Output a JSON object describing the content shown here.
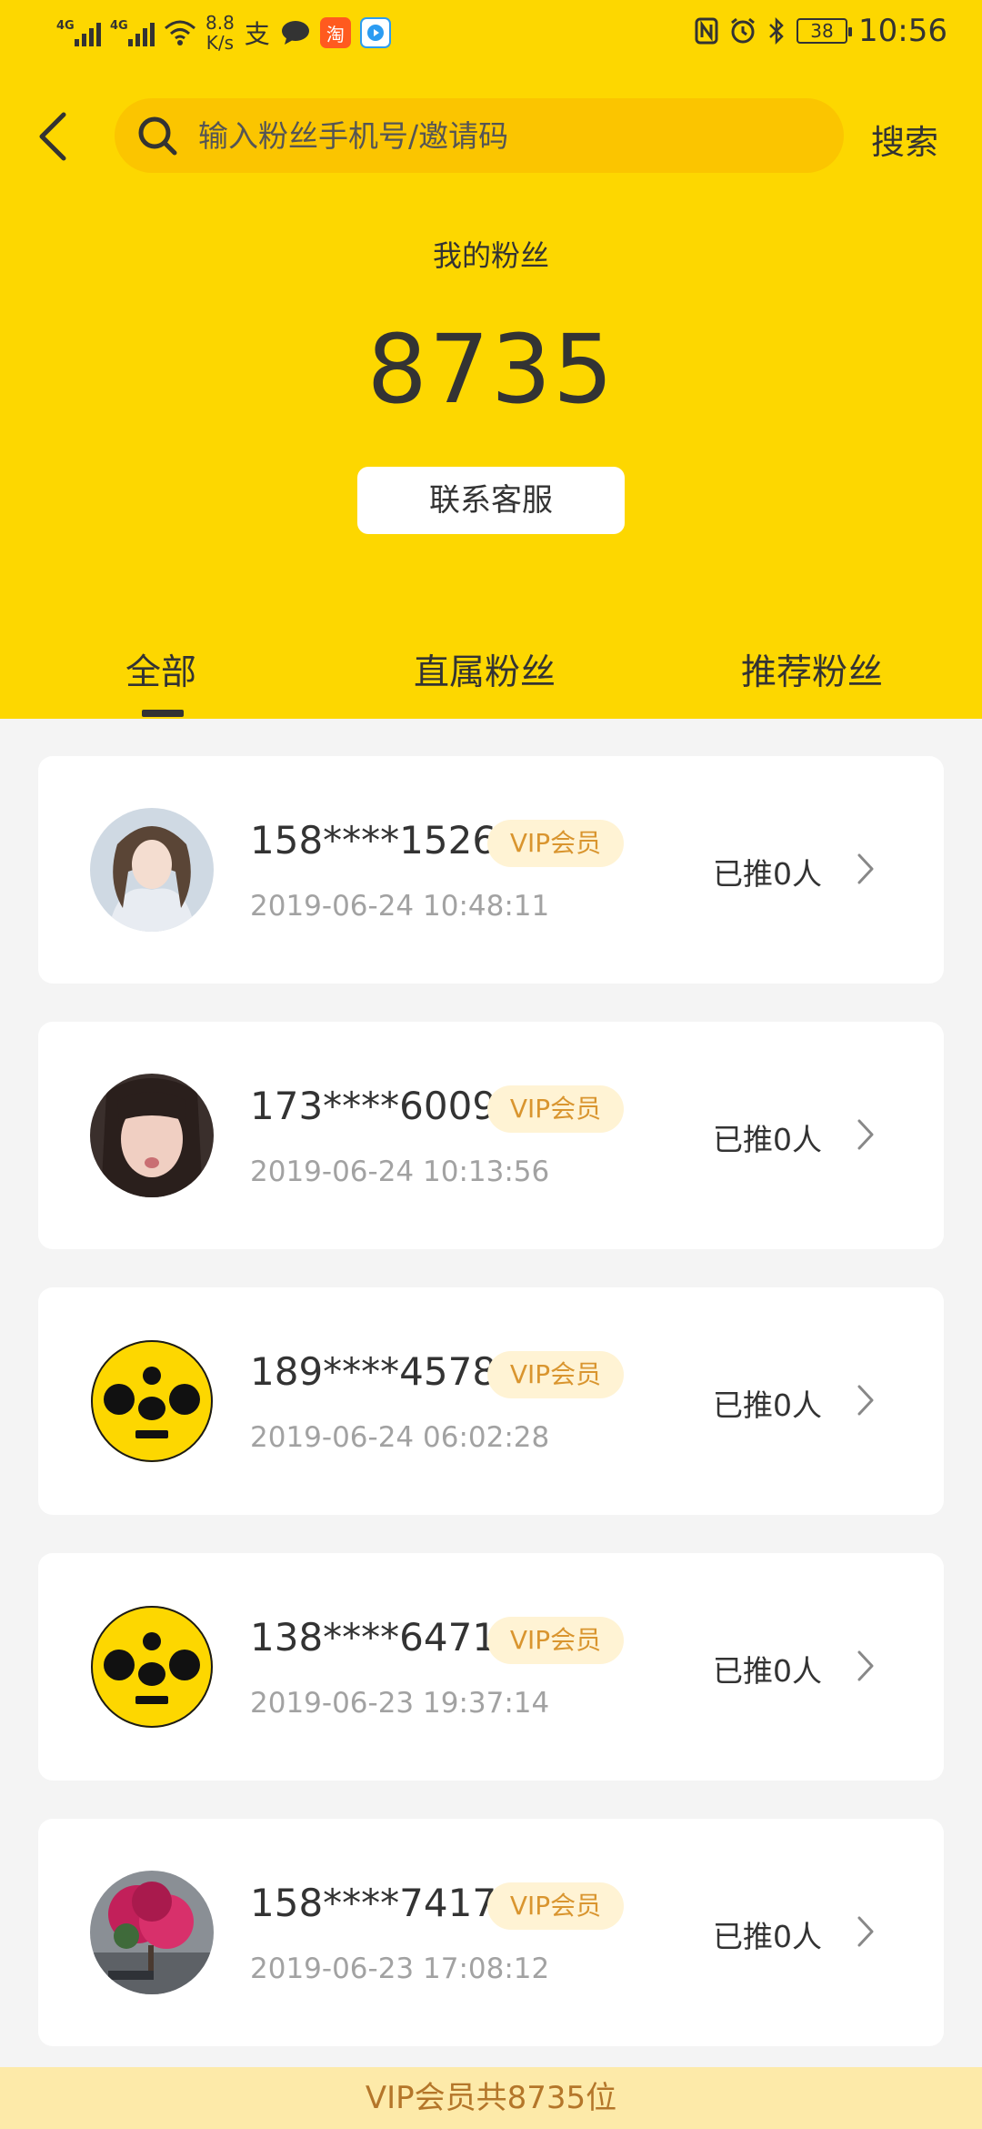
{
  "status_bar": {
    "net1": "4G",
    "net2": "4G",
    "speed_value": "8.8",
    "speed_unit": "K/s",
    "battery": "38",
    "time": "10:56",
    "icons": [
      "nfc-icon",
      "alarm-icon",
      "bluetooth-icon"
    ]
  },
  "search": {
    "placeholder": "输入粉丝手机号/邀请码",
    "button_label": "搜索"
  },
  "header": {
    "label": "我的粉丝",
    "count": "8735",
    "service_button": "联系客服"
  },
  "tabs": [
    "全部",
    "直属粉丝",
    "推荐粉丝"
  ],
  "active_tab": 0,
  "fans": [
    {
      "phone": "158****1526",
      "badge": "VIP会员",
      "time": "2019-06-24 10:48:11",
      "pushed": "已推0人",
      "avatar": "photo-girl-curly"
    },
    {
      "phone": "173****6009",
      "badge": "VIP会员",
      "time": "2019-06-24 10:13:56",
      "pushed": "已推0人",
      "avatar": "photo-girl-pout"
    },
    {
      "phone": "189****4578",
      "badge": "VIP会员",
      "time": "2019-06-24 06:02:28",
      "pushed": "已推0人",
      "avatar": "default-yellow-face"
    },
    {
      "phone": "138****6471",
      "badge": "VIP会员",
      "time": "2019-06-23 19:37:14",
      "pushed": "已推0人",
      "avatar": "default-yellow-face"
    },
    {
      "phone": "158****7417",
      "badge": "VIP会员",
      "time": "2019-06-23 17:08:12",
      "pushed": "已推0人",
      "avatar": "photo-flower-tree"
    }
  ],
  "footer": "VIP会员共8735位",
  "colors": {
    "brand_yellow": "#fdd700",
    "search_bg": "#fbc500",
    "vip_text": "#d9952f",
    "vip_bg": "#fff3d4",
    "footer_bg": "#fdeaa9"
  }
}
